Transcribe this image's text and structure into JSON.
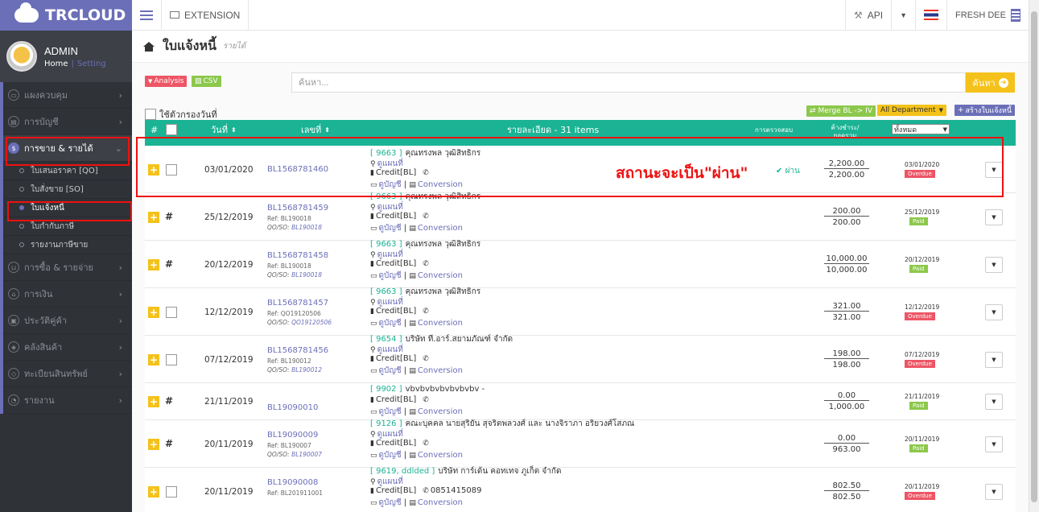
{
  "brand": {
    "name": "TRCLOUD"
  },
  "user": {
    "name": "ADMIN",
    "home_link": "Home",
    "setting_link": "Setting"
  },
  "sidebar": {
    "items": [
      {
        "label": "แผงควบคุม",
        "icon": "monitor-icon"
      },
      {
        "label": "การบัญชี",
        "icon": "book-icon"
      },
      {
        "label": "การขาย & รายได้",
        "icon": "dollar-icon"
      },
      {
        "label": "การซื้อ & รายจ่าย",
        "icon": "cart-icon"
      },
      {
        "label": "การเงิน",
        "icon": "bank-icon"
      },
      {
        "label": "ประวัติคู่ค้า",
        "icon": "contact-icon"
      },
      {
        "label": "คลังสินค้า",
        "icon": "cubes-icon"
      },
      {
        "label": "ทะเบียนสินทรัพย์",
        "icon": "diamond-icon"
      },
      {
        "label": "รายงาน",
        "icon": "report-icon"
      }
    ],
    "sub_items": [
      {
        "label": "ใบเสนอราคา [QO]"
      },
      {
        "label": "ใบสั่งขาย [SO]"
      },
      {
        "label": "ใบแจ้งหนี้"
      },
      {
        "label": "ใบกำกับภาษี"
      },
      {
        "label": "รายงานภาษีขาย"
      }
    ]
  },
  "topbar": {
    "extension": "EXTENSION",
    "api": "API",
    "company": "FRESH DEE"
  },
  "page": {
    "title": "ใบแจ้งหนี้",
    "subtitle": "รายได้"
  },
  "toolbar": {
    "analysis": "Analysis",
    "csv": "CSV",
    "search_placeholder": "ค้นหา...",
    "search_button": "ค้นหา",
    "date_filter_label": "ใช้ตัวกรองวันที่",
    "merge_button": "Merge BL -> IV",
    "department": "All Department",
    "create_button": "สร้างใบแจ้งหนี้"
  },
  "table": {
    "headers": {
      "hash": "#",
      "date": "วันที่",
      "docno": "เลขที่",
      "details": "รายละเอียด - 31 items",
      "check": "การตรวจสอบ",
      "amount": "ค้างชำระ/ยอดรวม",
      "filter": "ทั้งหมด"
    },
    "rows": [
      {
        "date": "03/01/2020",
        "docno": "BL1568781460",
        "ref": "",
        "qoso_label": "",
        "qoso": "",
        "code": "[ 9663 ]",
        "customer": "คุณทรงพล วุฒิสิทธิกร",
        "line2": "ดูแผนที่",
        "credit": "Credit[BL]",
        "phone": "",
        "line4a": "ดูบัญชี",
        "line4b": "Conversion",
        "status": "ผ่าน",
        "outstanding": "2,200.00",
        "total": "2,200.00",
        "due": "03/01/2020",
        "badge": "Overdue",
        "check": true
      },
      {
        "date": "25/12/2019",
        "docno": "BL1568781459",
        "ref": "Ref: BL190018",
        "qoso_label": "QO/SO: ",
        "qoso": "BL190018",
        "code": "[ 9663 ]",
        "customer": "คุณทรงพล วุฒิสิทธิกร",
        "line2": "ดูแผนที่",
        "credit": "Credit[BL]",
        "phone": "",
        "line4a": "ดูบัญชี",
        "line4b": "Conversion",
        "status": "",
        "outstanding": "200.00",
        "total": "200.00",
        "due": "25/12/2019",
        "badge": "Paid",
        "check": false
      },
      {
        "date": "20/12/2019",
        "docno": "BL1568781458",
        "ref": "Ref: BL190018",
        "qoso_label": "QO/SO: ",
        "qoso": "BL190018",
        "code": "[ 9663 ]",
        "customer": "คุณทรงพล วุฒิสิทธิกร",
        "line2": "ดูแผนที่",
        "credit": "Credit[BL]",
        "phone": "",
        "line4a": "ดูบัญชี",
        "line4b": "Conversion",
        "status": "",
        "outstanding": "10,000.00",
        "total": "10,000.00",
        "due": "20/12/2019",
        "badge": "Paid",
        "check": false
      },
      {
        "date": "12/12/2019",
        "docno": "BL1568781457",
        "ref": "Ref: QO19120506",
        "qoso_label": "QO/SO: ",
        "qoso": "QO19120506",
        "code": "[ 9663 ]",
        "customer": "คุณทรงพล วุฒิสิทธิกร",
        "line2": "ดูแผนที่",
        "credit": "Credit[BL]",
        "phone": "",
        "line4a": "ดูบัญชี",
        "line4b": "Conversion",
        "status": "",
        "outstanding": "321.00",
        "total": "321.00",
        "due": "12/12/2019",
        "badge": "Overdue",
        "check": true
      },
      {
        "date": "07/12/2019",
        "docno": "BL1568781456",
        "ref": "Ref: BL190012",
        "qoso_label": "QO/SO: ",
        "qoso": "BL190012",
        "code": "[ 9654 ]",
        "customer": "บริษัท ที.อาร์.สยามภัณฑ์ จำกัด",
        "line2": "ดูแผนที่",
        "credit": "Credit[BL]",
        "phone": "",
        "line4a": "ดูบัญชี",
        "line4b": "Conversion",
        "status": "",
        "outstanding": "198.00",
        "total": "198.00",
        "due": "07/12/2019",
        "badge": "Overdue",
        "check": true
      },
      {
        "date": "21/11/2019",
        "docno": "BL19090010",
        "ref": "",
        "qoso_label": "",
        "qoso": "",
        "code": "[ 9902 ]",
        "customer": "vbvbvbvbvbvbvbv -",
        "line2": "",
        "credit": "Credit[BL]",
        "phone": "",
        "line4a": "ดูบัญชี",
        "line4b": "Conversion",
        "status": "",
        "outstanding": "0.00",
        "total": "1,000.00",
        "due": "21/11/2019",
        "badge": "Paid",
        "check": false
      },
      {
        "date": "20/11/2019",
        "docno": "BL19090009",
        "ref": "Ref: BL190007",
        "qoso_label": "QO/SO: ",
        "qoso": "BL190007",
        "code": "[ 9126 ]",
        "customer": "คณะบุคคล นายสุริยัน สุจริตพลวงศ์ และ นางจิราภา อริยวงศ์โสภณ",
        "line2": "ดูแผนที่",
        "credit": "Credit[BL]",
        "phone": "",
        "line4a": "ดูบัญชี",
        "line4b": "Conversion",
        "status": "",
        "outstanding": "0.00",
        "total": "963.00",
        "due": "20/11/2019",
        "badge": "Paid",
        "check": false
      },
      {
        "date": "20/11/2019",
        "docno": "BL19090008",
        "ref": "Ref: BL201911001",
        "qoso_label": "",
        "qoso": "",
        "code": "[ 9619, ddlded ]",
        "customer": "บริษัท การ์เด้น คอทเทจ ภูเก็ต จำกัด",
        "line2": "ดูแผนที่",
        "credit": "Credit[BL]",
        "phone": "0851415089",
        "line4a": "ดูบัญชี",
        "line4b": "Conversion",
        "status": "",
        "outstanding": "802.50",
        "total": "802.50",
        "due": "20/11/2019",
        "badge": "Overdue",
        "check": true
      }
    ]
  },
  "annotation": {
    "text": "สถานะจะเป็น\"ผ่าน\""
  },
  "colors": {
    "accent": "#6b6fb8",
    "teal": "#1ab394",
    "yellow": "#f4c21a",
    "red": "#ed5565",
    "green": "#8cc84b"
  }
}
